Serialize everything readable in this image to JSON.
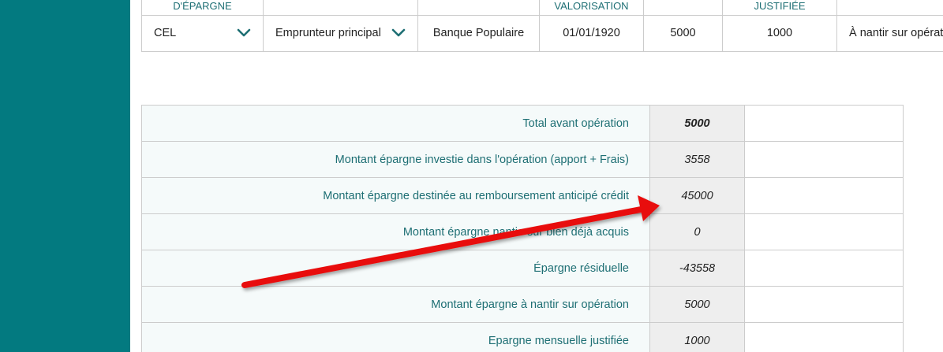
{
  "colors": {
    "sidebar": "#037a80",
    "label_text": "#1e6f74",
    "arrow": "#e8100c"
  },
  "savings_table": {
    "headers": [
      "D'ÉPARGNE",
      "",
      "",
      "VALORISATION",
      "",
      "JUSTIFIÉE",
      ""
    ],
    "row": {
      "type": "CEL",
      "emprunteur": "Emprunteur principal",
      "banque": "Banque Populaire",
      "date": "01/01/1920",
      "montant": "5000",
      "justifie": "1000",
      "nantir": "À nantir sur opération"
    }
  },
  "summary": {
    "rows": [
      {
        "label": "Total avant opération",
        "value": "5000"
      },
      {
        "label": "Montant épargne investie dans l'opération (apport + Frais)",
        "value": "3558"
      },
      {
        "label": "Montant épargne destinée au remboursement anticipé crédit",
        "value": "45000"
      },
      {
        "label": "Montant épargne nantie sur bien déjà acquis",
        "value": "0"
      },
      {
        "label": "Épargne résiduelle",
        "value": "-43558"
      },
      {
        "label": "Montant épargne à nantir sur opération",
        "value": "5000"
      },
      {
        "label": "Epargne mensuelle justifiée",
        "value": "1000"
      }
    ]
  }
}
